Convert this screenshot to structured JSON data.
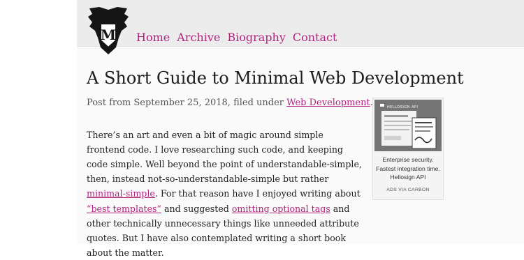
{
  "nav": {
    "items": [
      {
        "label": "Home"
      },
      {
        "label": "Archive"
      },
      {
        "label": "Biography"
      },
      {
        "label": "Contact"
      }
    ]
  },
  "logo": {
    "letter": "M"
  },
  "article": {
    "title": "A Short Guide to Minimal Web Development",
    "meta_prefix": "Post from September 25, 2018, filed under ",
    "meta_category": "Web Development",
    "meta_suffix": ".",
    "p1": "There’s an art and even a bit of magic around simple frontend code. I love researching such code, and keeping code simple. Well beyond the point of understandable-simple, then, instead not-so-understandable-simple but rather ",
    "link1": "minimal-simple",
    "p2": ". For that reason have I enjoyed writing about ",
    "link2": "“best templates”",
    "p3": " and suggested ",
    "link3": "omitting optional tags",
    "p4": " and other technically unnecessary things like unneeded attribute quotes. But I have also contemplated writing a short book about the matter."
  },
  "ad": {
    "brand": "HELLOSIGN API",
    "text": "Enterprise security. Fastest integration time. Hellosign API",
    "via": "ADS VIA CARBON"
  },
  "colors": {
    "link": "#b0247f",
    "header_bg": "#ececec"
  }
}
